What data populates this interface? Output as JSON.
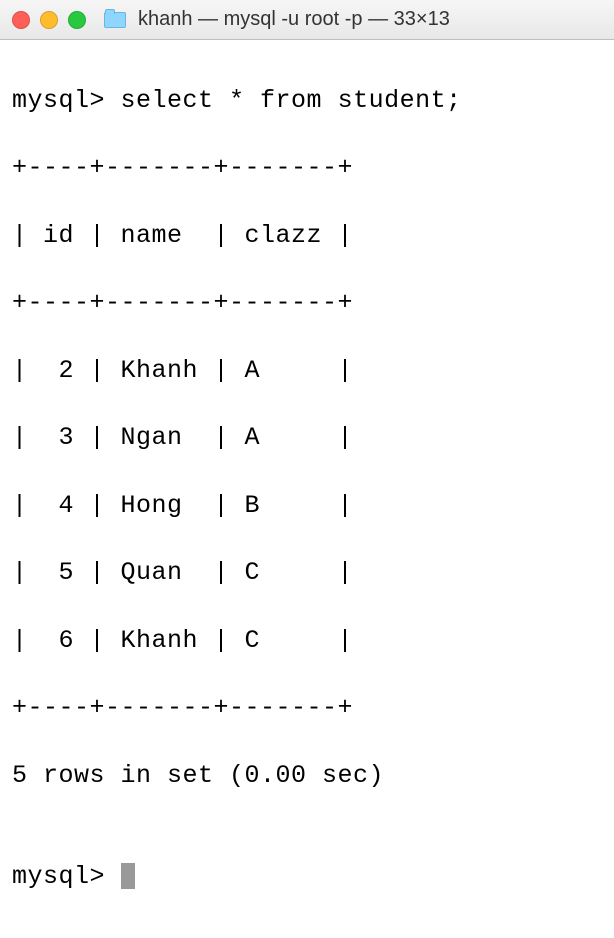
{
  "window": {
    "title": "khanh — mysql -u root -p — 33×13"
  },
  "terminal": {
    "prompt": "mysql>",
    "command": "select * from student;",
    "table": {
      "columns": [
        "id",
        "name",
        "clazz"
      ],
      "rows": [
        {
          "id": 2,
          "name": "Khanh",
          "clazz": "A"
        },
        {
          "id": 3,
          "name": "Ngan",
          "clazz": "A"
        },
        {
          "id": 4,
          "name": "Hong",
          "clazz": "B"
        },
        {
          "id": 5,
          "name": "Quan",
          "clazz": "C"
        },
        {
          "id": 6,
          "name": "Khanh",
          "clazz": "C"
        }
      ]
    },
    "status": "5 rows in set (0.00 sec)",
    "border_top": "+----+-------+-------+",
    "header_line": "| id | name  | clazz |",
    "border_mid": "+----+-------+-------+",
    "row_lines": [
      "|  2 | Khanh | A     |",
      "|  3 | Ngan  | A     |",
      "|  4 | Hong  | B     |",
      "|  5 | Quan  | C     |",
      "|  6 | Khanh | C     |"
    ],
    "border_bot": "+----+-------+-------+"
  }
}
